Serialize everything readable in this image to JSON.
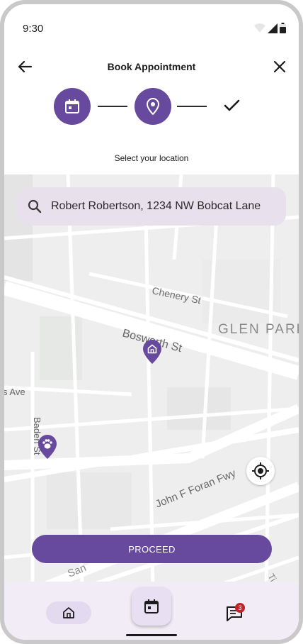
{
  "status_bar": {
    "time": "9:30"
  },
  "app_bar": {
    "title": "Book Appointment"
  },
  "stepper": {
    "subtitle": "Select your location"
  },
  "search": {
    "value": "Robert Robertson, 1234 NW Bobcat Lane"
  },
  "map": {
    "labels": {
      "chenery": "Chenery St",
      "glen_park": "GLEN PARK",
      "bosworth": "Bosworth St",
      "ave": "s Ave",
      "baden": "Baden St",
      "john_f_foran": "John F Foran Fwy",
      "san": "San",
      "ti": "Ti"
    }
  },
  "actions": {
    "proceed_label": "PROCEED"
  },
  "bottom_nav": {
    "messages_badge": "3"
  },
  "colors": {
    "primary": "#674a9e",
    "nav_bg": "#f2ecf6",
    "badge": "#c0252c"
  }
}
